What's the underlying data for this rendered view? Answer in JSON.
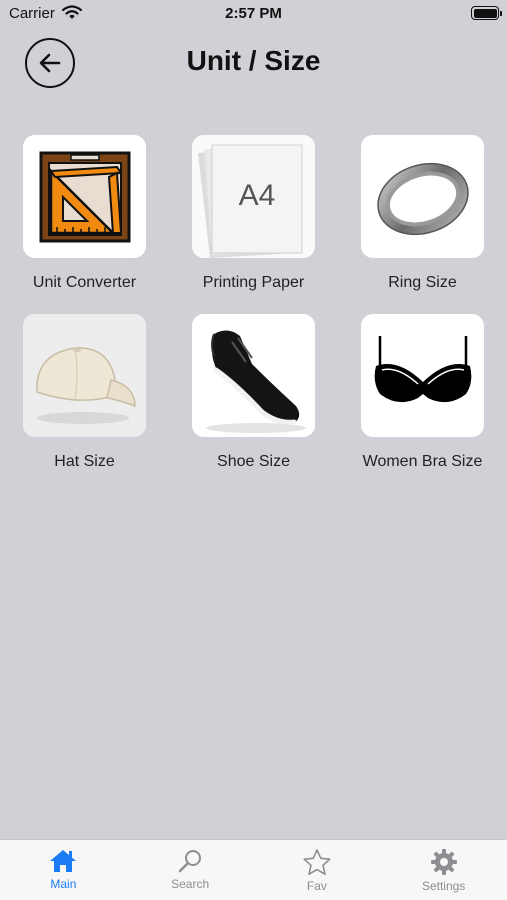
{
  "status_bar": {
    "carrier": "Carrier",
    "time": "2:57 PM"
  },
  "header": {
    "title": "Unit / Size",
    "back_icon": "arrow-left-circle-icon"
  },
  "items": [
    {
      "label": "Unit Converter",
      "icon": "ruler-triangle-icon"
    },
    {
      "label": "Printing Paper",
      "icon": "paper-a4-icon",
      "badge_text": "A4"
    },
    {
      "label": "Ring Size",
      "icon": "ring-icon"
    },
    {
      "label": "Hat Size",
      "icon": "cap-icon"
    },
    {
      "label": "Shoe Size",
      "icon": "sneaker-icon"
    },
    {
      "label": "Women Bra Size",
      "icon": "bra-icon"
    }
  ],
  "tab_bar": {
    "active_color": "#1a7cf5",
    "inactive_color": "#8e8e93",
    "tabs": [
      {
        "label": "Main",
        "icon": "home-icon",
        "active": true
      },
      {
        "label": "Search",
        "icon": "search-icon",
        "active": false
      },
      {
        "label": "Fav",
        "icon": "star-icon",
        "active": false
      },
      {
        "label": "Settings",
        "icon": "gear-icon",
        "active": false
      }
    ]
  }
}
